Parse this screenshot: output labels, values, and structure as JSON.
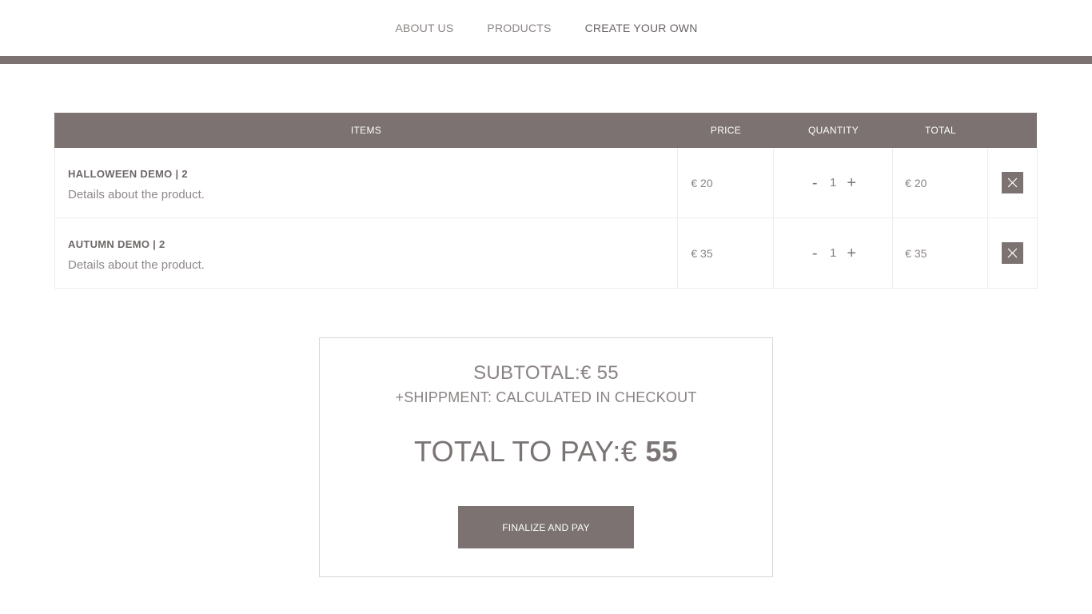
{
  "nav": {
    "items": [
      {
        "label": "ABOUT US"
      },
      {
        "label": "PRODUCTS"
      },
      {
        "label": "CREATE YOUR OWN"
      }
    ]
  },
  "cart": {
    "headers": {
      "items": "ITEMS",
      "price": "PRICE",
      "quantity": "QUANTITY",
      "total": "TOTAL"
    },
    "rows": [
      {
        "name": "HALLOWEEN DEMO | 2",
        "description": "Details about the product.",
        "price": "€ 20",
        "quantity": "1",
        "total": "€ 20",
        "minus": "-",
        "plus": "+"
      },
      {
        "name": "AUTUMN DEMO | 2",
        "description": "Details about the product.",
        "price": "€ 35",
        "quantity": "1",
        "total": "€ 35",
        "minus": "-",
        "plus": "+"
      }
    ]
  },
  "summary": {
    "subtotal_label": "SUBTOTAL:",
    "subtotal_value": "€ 55",
    "shipping": "+SHIPPMENT: CALCULATED IN CHECKOUT",
    "total_label": "TOTAL TO PAY:",
    "total_currency": "€ ",
    "total_amount": "55",
    "pay_button": "FINALIZE AND PAY"
  },
  "colors": {
    "accent": "#7b7271",
    "text": "#8a8383",
    "border": "#ececec"
  }
}
